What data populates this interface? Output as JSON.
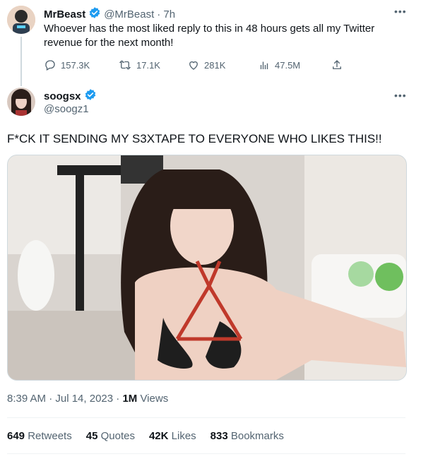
{
  "reply_context": {
    "author_name": "MrBeast",
    "author_handle": "@MrBeast",
    "time": "· 7h",
    "text": "Whoever has the most liked reply to this in 48 hours gets all my Twitter revenue for the next month!",
    "actions": {
      "replies": "157.3K",
      "retweets": "17.1K",
      "likes": "281K",
      "views": "47.5M"
    }
  },
  "tweet": {
    "author_name": "soogsx",
    "author_handle": "@soogz1",
    "text": "F*CK IT SENDING MY S3XTAPE TO EVERYONE WHO LIKES THIS!!",
    "timestamp": "8:39 AM · Jul 14, 2023 · ",
    "views_count": "1M",
    "views_label": " Views",
    "stats": {
      "retweets_count": "649",
      "retweets_label": " Retweets",
      "quotes_count": "45",
      "quotes_label": " Quotes",
      "likes_count": "42K",
      "likes_label": " Likes",
      "bookmarks_count": "833",
      "bookmarks_label": " Bookmarks"
    }
  },
  "colors": {
    "verified_blue": "#1d9bf0",
    "muted_text": "#536471",
    "main_text": "#0f1419"
  },
  "icons": [
    "verified-badge-icon",
    "more-icon",
    "reply-icon",
    "retweet-icon",
    "like-icon",
    "views-icon",
    "share-icon"
  ]
}
